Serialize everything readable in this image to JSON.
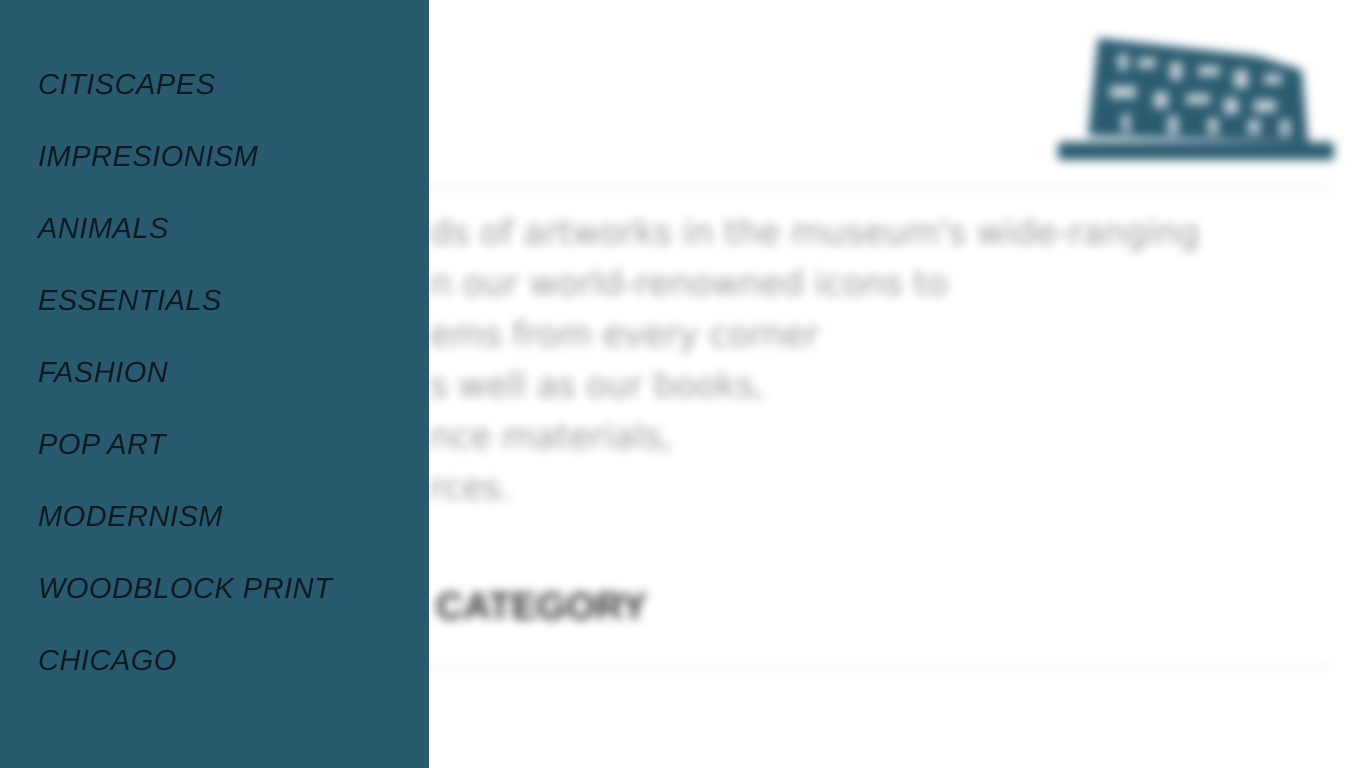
{
  "colors": {
    "drawer_background": "#2a5a70",
    "drawer_text": "#0d1a22",
    "logo": "#2a5a70"
  },
  "logo": {
    "icon": "museum-logo-icon"
  },
  "intro": {
    "lines": [
      "ds of artworks in the museum's wide-ranging",
      "n our world-renowned icons to",
      "ems from every corner",
      "s well as our books,",
      "nce materials,",
      "rces."
    ]
  },
  "category_heading": "CATEGORY",
  "drawer": {
    "items": [
      {
        "label": "CITISCAPES"
      },
      {
        "label": "IMPRESIONISM"
      },
      {
        "label": "ANIMALS"
      },
      {
        "label": "ESSENTIALS"
      },
      {
        "label": "FASHION"
      },
      {
        "label": "POP ART"
      },
      {
        "label": "MODERNISM"
      },
      {
        "label": "WOODBLOCK PRINT"
      },
      {
        "label": "CHICAGO"
      }
    ]
  }
}
